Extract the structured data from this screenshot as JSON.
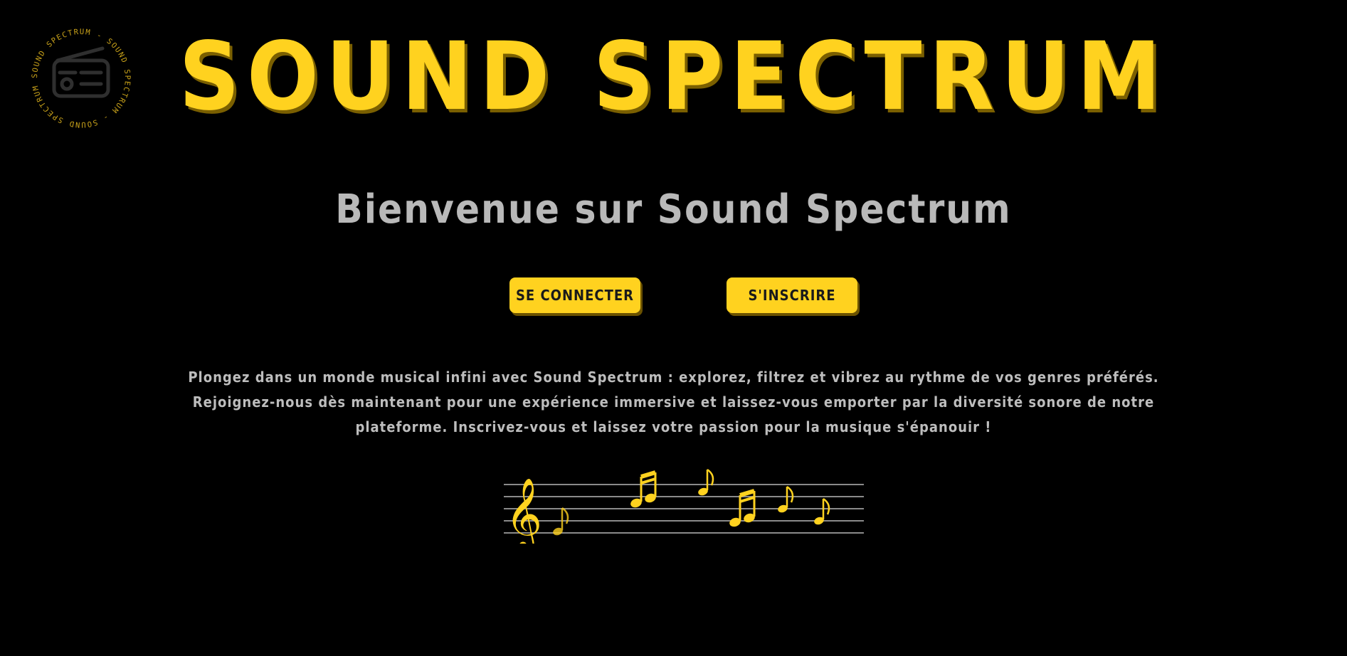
{
  "brand": {
    "title": "SOUND SPECTRUM",
    "logo_ring_text": "SOUND SPECTRUM - SOUND SPECTRUM - SOUND SPECTRUM -",
    "accent_color": "#ffd21f",
    "logo_icon": "radio-icon"
  },
  "hero": {
    "welcome": "Bienvenue sur Sound Spectrum"
  },
  "actions": {
    "login_label": "SE CONNECTER",
    "signup_label": "S'INSCRIRE"
  },
  "intro": {
    "text": "Plongez dans un monde musical infini avec Sound Spectrum : explorez, filtrez et vibrez au rythme de vos genres préférés. Rejoignez-nous dès maintenant pour une expérience immersive et laissez-vous emporter par la diversité sonore de notre plateforme. Inscrivez-vous et laissez votre passion pour la musique s'épanouir !"
  },
  "decoration": {
    "icon": "music-staff-icon",
    "note_color": "#ffd21f",
    "line_color": "#8a8a8a"
  }
}
